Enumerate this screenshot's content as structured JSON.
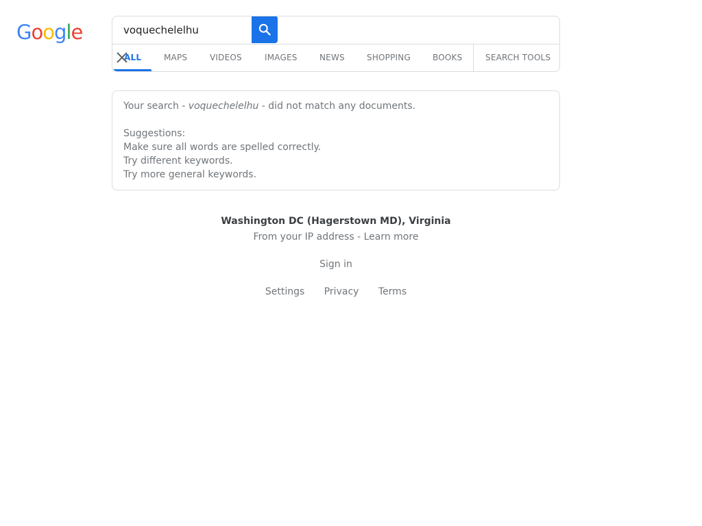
{
  "logo": {
    "letters": [
      "G",
      "o",
      "o",
      "g",
      "l",
      "e"
    ],
    "colors": [
      "#4285f4",
      "#ea4335",
      "#fbbc05",
      "#4285f4",
      "#34a853",
      "#ea4335"
    ]
  },
  "search": {
    "query": "voquechelelhu"
  },
  "tabs": [
    {
      "label": "ALL",
      "active": true
    },
    {
      "label": "MAPS"
    },
    {
      "label": "VIDEOS"
    },
    {
      "label": "IMAGES"
    },
    {
      "label": "NEWS"
    },
    {
      "label": "SHOPPING"
    },
    {
      "label": "BOOKS"
    },
    {
      "label": "SEARCH TOOLS"
    }
  ],
  "result": {
    "prefix": "Your search - ",
    "query": "voquechelelhu",
    "suffix": " - did not match any documents.",
    "suggestions_title": "Suggestions:",
    "suggestions": [
      "Make sure all words are spelled correctly.",
      "Try different keywords.",
      "Try more general keywords."
    ]
  },
  "footer": {
    "location": "Washington DC (Hagerstown MD), Virginia",
    "location_source": "From your IP address - Learn more",
    "sign_in": "Sign in",
    "links": [
      "Settings",
      "Privacy",
      "Terms"
    ]
  },
  "colors": {
    "accent": "#1a73e8",
    "muted_text": "#70757a",
    "border": "#dadce0"
  }
}
